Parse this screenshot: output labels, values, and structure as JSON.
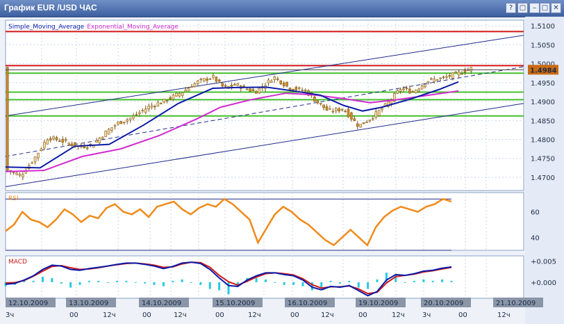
{
  "window": {
    "title": "График EUR /USD  ЧАС",
    "buttons": {
      "help": "?",
      "restore": "▢",
      "minimize": "–",
      "maximize": "□",
      "close": "✕"
    }
  },
  "colors": {
    "bull_candle": "#c88a2c",
    "bear_candle": "#c88a2c",
    "sma": "#0a1aa8",
    "ema": "#d22ad0",
    "support_lines": "#44c02c",
    "resistance_line": "#d01818",
    "trend_channel": "#1e2a8a",
    "rsi_line": "#f08a1a",
    "macd_line": "#0a1aa8",
    "signal_line": "#d01818",
    "histogram": "#28c8e0"
  },
  "chart_data": [
    {
      "type": "candlestick",
      "legend": [
        "Simple_Moving_Average",
        "Exponential_Moving_Average"
      ],
      "y_ticks": [
        "1.5100",
        "1.5050",
        "1.5000",
        "1.4950",
        "1.4900",
        "1.4850",
        "1.4800",
        "1.4750",
        "1.4700"
      ],
      "ylim": [
        1.4665,
        1.5115
      ],
      "current_price": "1.4984",
      "horizontal_levels": {
        "resistance": [
          1.5085,
          1.4995
        ],
        "support": [
          1.4975,
          1.4925,
          1.4905,
          1.4862
        ]
      },
      "x_dates": [
        "12.10.2009",
        "13.10.2009",
        "14.10.2009",
        "15.10.2009",
        "16.10.2009",
        "19.10.2009",
        "20.10.2009",
        "21.10.2009"
      ],
      "x_hours": [
        "3ч",
        "00",
        "12ч",
        "00",
        "12ч",
        "00",
        "12ч",
        "00",
        "12ч",
        "00",
        "12ч",
        "3ч",
        "00",
        "12ч",
        "00",
        "12ч",
        "00"
      ],
      "close_path": [
        [
          0,
          1.472
        ],
        [
          8,
          1.4705
        ],
        [
          15,
          1.475
        ],
        [
          22,
          1.4805
        ],
        [
          30,
          1.4795
        ],
        [
          38,
          1.478
        ],
        [
          45,
          1.4785
        ],
        [
          52,
          1.4818
        ],
        [
          58,
          1.4842
        ],
        [
          66,
          1.4858
        ],
        [
          74,
          1.4885
        ],
        [
          82,
          1.49
        ],
        [
          92,
          1.4925
        ],
        [
          100,
          1.4952
        ],
        [
          108,
          1.4965
        ],
        [
          114,
          1.4935
        ],
        [
          120,
          1.4945
        ],
        [
          130,
          1.4925
        ],
        [
          140,
          1.4965
        ],
        [
          148,
          1.4935
        ],
        [
          156,
          1.493
        ],
        [
          162,
          1.49
        ],
        [
          168,
          1.4875
        ],
        [
          176,
          1.488
        ],
        [
          184,
          1.4835
        ],
        [
          190,
          1.4855
        ],
        [
          198,
          1.489
        ],
        [
          206,
          1.4935
        ],
        [
          212,
          1.4925
        ],
        [
          220,
          1.4955
        ],
        [
          228,
          1.4962
        ],
        [
          236,
          1.4975
        ],
        [
          244,
          1.499
        ]
      ],
      "sma_path": [
        [
          0,
          1.4727
        ],
        [
          18,
          1.4725
        ],
        [
          36,
          1.4782
        ],
        [
          54,
          1.4787
        ],
        [
          72,
          1.4838
        ],
        [
          90,
          1.4895
        ],
        [
          108,
          1.4935
        ],
        [
          120,
          1.4937
        ],
        [
          136,
          1.4938
        ],
        [
          150,
          1.4928
        ],
        [
          164,
          1.4917
        ],
        [
          176,
          1.489
        ],
        [
          186,
          1.4875
        ],
        [
          196,
          1.4885
        ],
        [
          210,
          1.4905
        ],
        [
          226,
          1.4932
        ],
        [
          236,
          1.4952
        ]
      ],
      "ema_path": [
        [
          0,
          1.4715
        ],
        [
          20,
          1.4718
        ],
        [
          40,
          1.4755
        ],
        [
          60,
          1.4775
        ],
        [
          80,
          1.481
        ],
        [
          100,
          1.4855
        ],
        [
          112,
          1.4885
        ],
        [
          128,
          1.4905
        ],
        [
          146,
          1.4922
        ],
        [
          160,
          1.4918
        ],
        [
          176,
          1.4908
        ],
        [
          190,
          1.4897
        ],
        [
          204,
          1.4905
        ],
        [
          222,
          1.4918
        ],
        [
          236,
          1.4928
        ]
      ],
      "trend_channel": [
        [
          [
            0,
            1.4862
          ],
          [
            270,
            1.5075
          ]
        ],
        [
          [
            0,
            1.4755
          ],
          [
            270,
            1.4992
          ]
        ],
        [
          [
            0,
            1.4675
          ],
          [
            270,
            1.4895
          ]
        ]
      ]
    },
    {
      "type": "line",
      "label": "RSI",
      "y_ticks": [
        "60",
        "40"
      ],
      "ylim": [
        30,
        75
      ],
      "levels": [
        70,
        30
      ],
      "values": [
        45,
        50,
        60,
        54,
        52,
        48,
        54,
        62,
        58,
        52,
        57,
        55,
        63,
        66,
        60,
        58,
        62,
        56,
        64,
        66,
        68,
        62,
        58,
        63,
        66,
        64,
        70,
        66,
        60,
        54,
        36,
        47,
        58,
        64,
        60,
        54,
        50,
        44,
        38,
        34,
        40,
        46,
        40,
        34,
        48,
        56,
        61,
        64,
        62,
        60,
        64,
        66,
        70,
        68
      ]
    },
    {
      "type": "line",
      "label": "MACD",
      "y_ticks": [
        "+0.005",
        "+0.000"
      ],
      "ylim": [
        -0.0038,
        0.0062
      ],
      "macd": [
        -0.0005,
        -0.0003,
        0.0005,
        0.0015,
        0.003,
        0.004,
        0.0038,
        0.003,
        0.0028,
        0.0032,
        0.0035,
        0.0038,
        0.0042,
        0.0045,
        0.0045,
        0.0042,
        0.0038,
        0.0032,
        0.0037,
        0.0045,
        0.0047,
        0.0044,
        0.003,
        0.001,
        -0.0008,
        -0.001,
        0.0005,
        0.0015,
        0.0022,
        0.0022,
        0.0018,
        0.0015,
        0.0005,
        -0.0012,
        -0.0018,
        -0.001,
        -0.0012,
        -0.0008,
        -0.002,
        -0.0032,
        -0.0022,
        0.0005,
        0.0018,
        0.0016,
        0.002,
        0.0026,
        0.0028,
        0.0033,
        0.0036
      ],
      "signal": [
        -0.0002,
        -0.0001,
        0.0004,
        0.0014,
        0.0026,
        0.0037,
        0.0039,
        0.0034,
        0.003,
        0.0031,
        0.0034,
        0.0038,
        0.0041,
        0.0044,
        0.0045,
        0.0043,
        0.004,
        0.0035,
        0.0036,
        0.0043,
        0.0047,
        0.0046,
        0.0035,
        0.0016,
        0.0001,
        -0.0007,
        0.0002,
        0.0012,
        0.002,
        0.0022,
        0.002,
        0.0017,
        0.0008,
        -0.0006,
        -0.0014,
        -0.0011,
        -0.0011,
        -0.0009,
        -0.0016,
        -0.0027,
        -0.0024,
        -0.0002,
        0.0013,
        0.0016,
        0.0019,
        0.0024,
        0.0027,
        0.0031,
        0.0035
      ]
    }
  ]
}
